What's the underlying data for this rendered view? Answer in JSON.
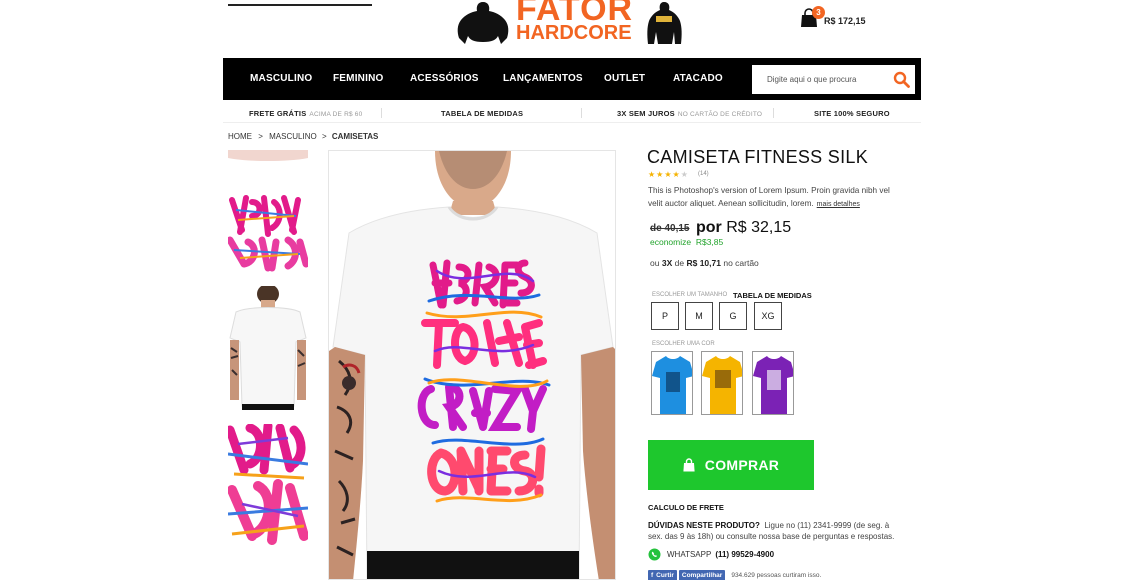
{
  "header": {
    "logo_line1": "FATOR",
    "logo_line2": "HARDCORE",
    "cart_count": "3",
    "cart_total": "R$ 172,15"
  },
  "nav": {
    "items": [
      "MASCULINO",
      "FEMININO",
      "ACESSÓRIOS",
      "LANÇAMENTOS",
      "OUTLET",
      "ATACADO"
    ],
    "search_placeholder": "Digite aqui o que procura"
  },
  "infobar": {
    "frete": "FRETE GRÁTIS",
    "frete_sub": "ACIMA DE R$ 60",
    "medidas": "TABELA DE MEDIDAS",
    "juros": "3X SEM JUROS",
    "juros_sub": "NO CARTÃO DE CRÉDITO",
    "seguro": "SITE 100% SEGURO"
  },
  "breadcrumb": {
    "home": "HOME",
    "category": "MASCULINO",
    "current": "CAMISETAS",
    "sep": ">"
  },
  "product": {
    "title": "CAMISETA FITNESS SILK",
    "rating": 4,
    "rating_max": 5,
    "rating_count": "(14)",
    "description": "This is Photoshop's version  of Lorem Ipsum. Proin gravida nibh vel velit auctor aliquet. Aenean sollicitudin, lorem.",
    "more_details": "mais detalhes",
    "old_price": "de 40,15",
    "price_prefix": "por",
    "price": "R$ 32,15",
    "economize_label": "economize",
    "economize_value": "R$3,85",
    "installments_pre": "ou",
    "installments_bold": "3X",
    "installments_mid": "de",
    "installments_value": "R$ 10,71",
    "installments_post": "no cartão",
    "size_label": "ESCOLHER UM TAMANHO",
    "size_table": "TABELA DE MEDIDAS",
    "sizes": [
      "P",
      "M",
      "G",
      "XG"
    ],
    "color_label": "ESCOLHER UMA COR",
    "colors": [
      "#1e8fe0",
      "#f5b400",
      "#7b22b5"
    ],
    "buy_label": "COMPRAR",
    "frete_title": "CALCULO DE FRETE",
    "duvidas_title": "DÚVIDAS NESTE PRODUTO?",
    "duvidas_text": "Ligue no (11) 2341-9999 (de seg. à sex. das 9 às 18h) ou consulte nossa base de perguntas e respostas.",
    "whatsapp_label": "WHATSAPP",
    "whatsapp_number": "(11) 99529-4900",
    "fb_like": "Curtir",
    "fb_share": "Compartilhar",
    "fb_count": "934.629 pessoas curtiram isso."
  },
  "colors": {
    "accent": "#f26522",
    "buy": "#1ec72d",
    "nav_bg": "#000000"
  }
}
